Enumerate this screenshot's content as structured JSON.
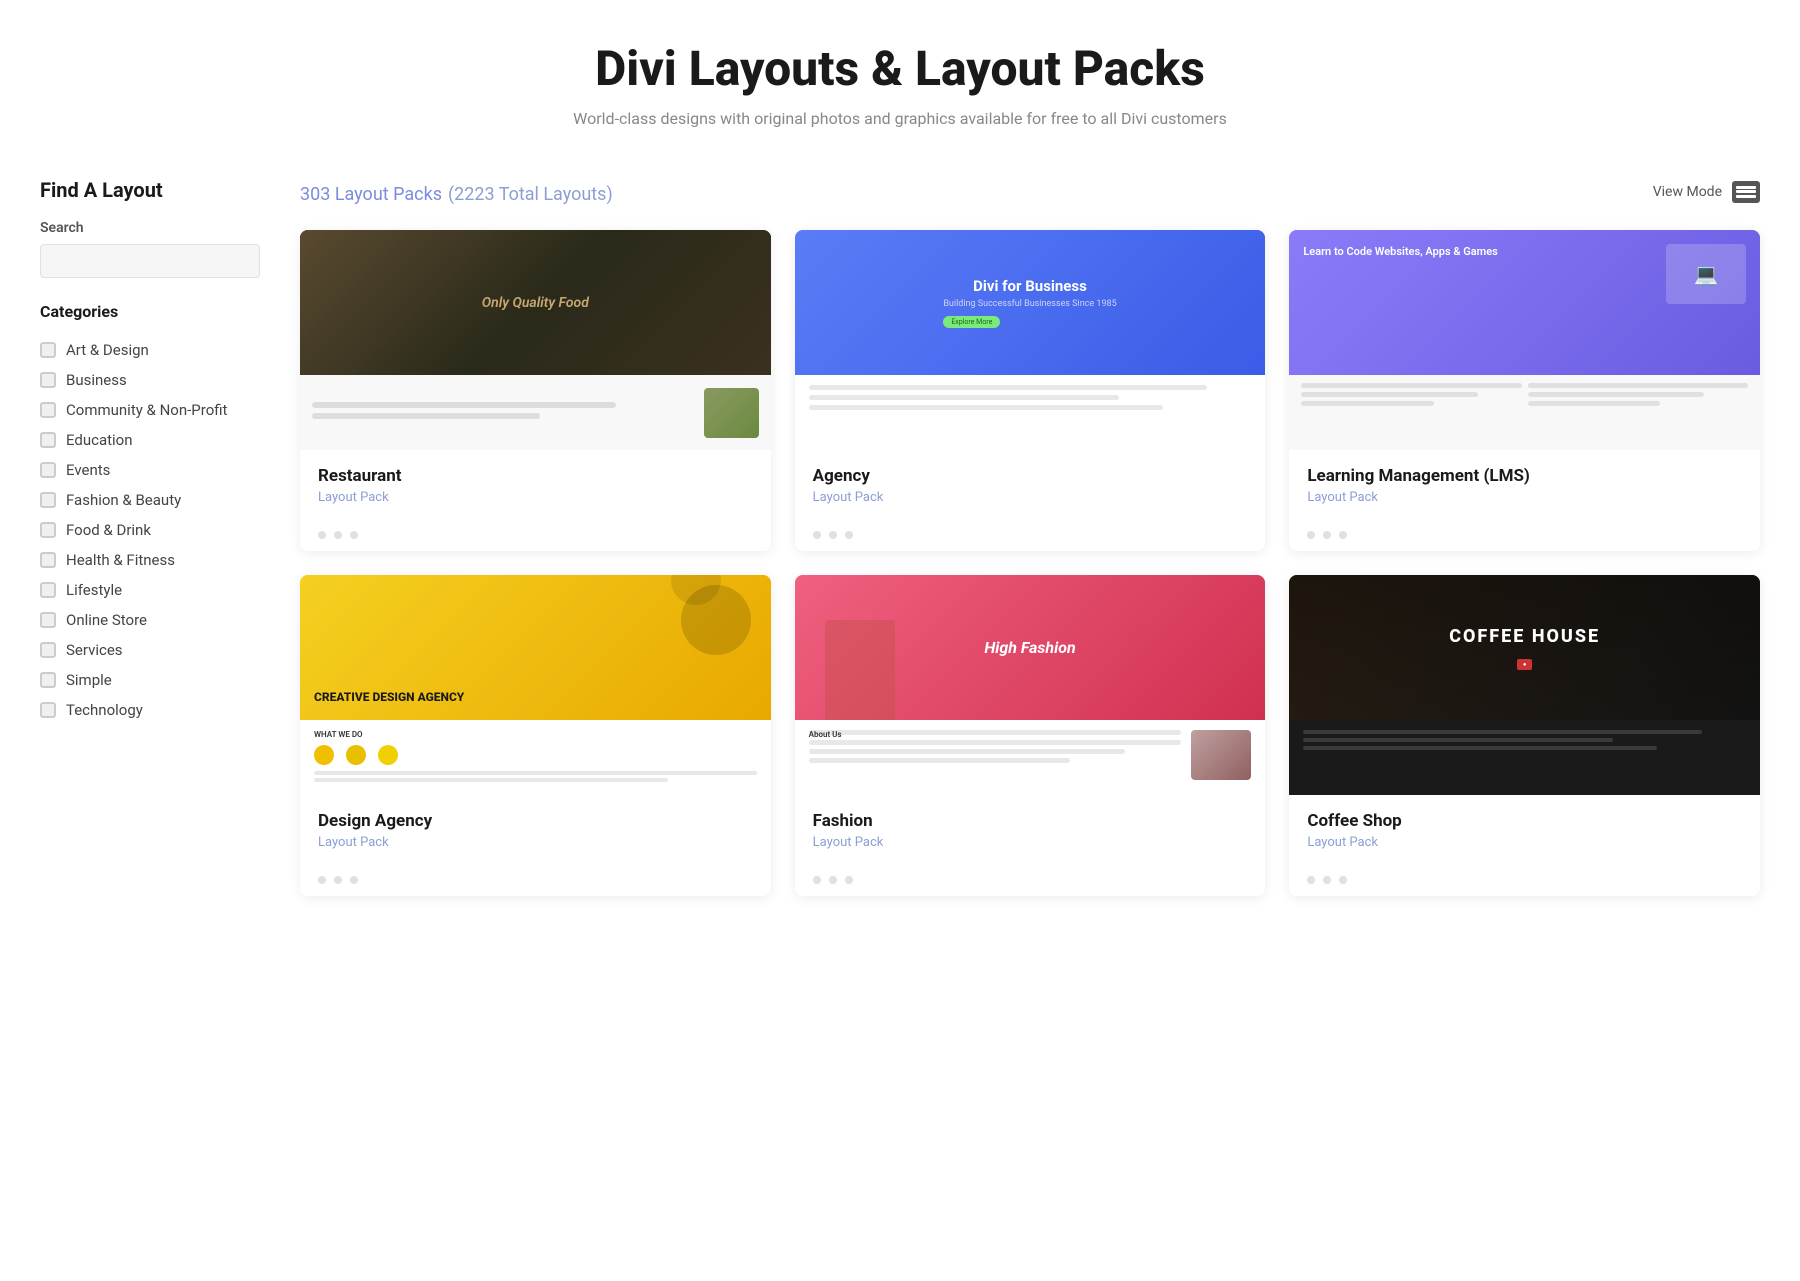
{
  "header": {
    "title": "Divi Layouts & Layout Packs",
    "subtitle": "World-class designs with original photos and graphics available for free to all Divi customers"
  },
  "sidebar": {
    "title": "Find A Layout",
    "search": {
      "label": "Search",
      "placeholder": ""
    },
    "categories_title": "Categories",
    "categories": [
      {
        "id": "art-design",
        "label": "Art & Design",
        "checked": false
      },
      {
        "id": "business",
        "label": "Business",
        "checked": false
      },
      {
        "id": "community",
        "label": "Community & Non-Profit",
        "checked": false
      },
      {
        "id": "education",
        "label": "Education",
        "checked": false
      },
      {
        "id": "events",
        "label": "Events",
        "checked": false
      },
      {
        "id": "fashion-beauty",
        "label": "Fashion & Beauty",
        "checked": false
      },
      {
        "id": "food-drink",
        "label": "Food & Drink",
        "checked": false
      },
      {
        "id": "health-fitness",
        "label": "Health & Fitness",
        "checked": false
      },
      {
        "id": "lifestyle",
        "label": "Lifestyle",
        "checked": false
      },
      {
        "id": "online-store",
        "label": "Online Store",
        "checked": false
      },
      {
        "id": "services",
        "label": "Services",
        "checked": false
      },
      {
        "id": "simple",
        "label": "Simple",
        "checked": false
      },
      {
        "id": "technology",
        "label": "Technology",
        "checked": false
      }
    ]
  },
  "content": {
    "count_label": "303 Layout Packs",
    "total_label": "(2223 Total Layouts)",
    "view_mode_label": "View Mode",
    "cards": [
      {
        "id": "restaurant",
        "title": "Restaurant",
        "type": "Layout Pack",
        "theme": "restaurant",
        "hero_text": "Only Quality Food"
      },
      {
        "id": "agency",
        "title": "Agency",
        "type": "Layout Pack",
        "theme": "agency",
        "hero_text": "Divi for Business"
      },
      {
        "id": "lms",
        "title": "Learning Management (LMS)",
        "type": "Layout Pack",
        "theme": "lms",
        "hero_text": "Learn to Code Websites, Apps & Games"
      },
      {
        "id": "design-agency",
        "title": "Design Agency",
        "type": "Layout Pack",
        "theme": "design",
        "hero_text": "CREATIVE DESIGN AGENCY"
      },
      {
        "id": "fashion",
        "title": "Fashion",
        "type": "Layout Pack",
        "theme": "fashion",
        "hero_text": "High Fashion"
      },
      {
        "id": "coffee-shop",
        "title": "Coffee Shop",
        "type": "Layout Pack",
        "theme": "coffee",
        "hero_text": "COFFEE HOUSE"
      }
    ]
  }
}
